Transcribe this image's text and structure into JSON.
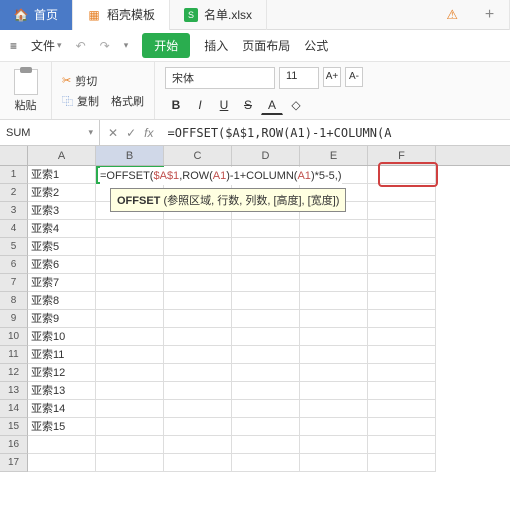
{
  "tabs": {
    "home": "首页",
    "template": "稻壳模板",
    "file_name": "名单.xlsx"
  },
  "menu": {
    "hamburger": "≡",
    "file": "文件",
    "undo": "↶",
    "redo": "↷",
    "start": "开始",
    "insert": "插入",
    "layout": "页面布局",
    "formula": "公式"
  },
  "toolbar": {
    "paste": "粘贴",
    "cut": "剪切",
    "copy": "复制",
    "format": "格式刷",
    "font_name": "宋体",
    "font_size": "11",
    "size_up": "A+",
    "size_down": "A-",
    "bold": "B",
    "italic": "I",
    "underline": "U",
    "strike": "S",
    "fontA": "A",
    "fill": "◇"
  },
  "formula_bar": {
    "name_box": "SUM",
    "cancel": "✕",
    "confirm": "✓",
    "fx": "fx",
    "value": "=OFFSET($A$1,ROW(A1)-1+COLUMN(A"
  },
  "columns": [
    "A",
    "B",
    "C",
    "D",
    "E",
    "F"
  ],
  "cell_formula": {
    "pre": "=OFFSET(",
    "ref1": "$A$1",
    "mid1": ",ROW(",
    "ref2": "A1",
    "mid2": ")-1+COLUMN(",
    "ref3": "A1",
    "mid3": ")",
    "tail": "*5-5,)"
  },
  "tooltip": {
    "fn": "OFFSET",
    "args": " (参照区域, 行数, 列数, [高度], [宽度])"
  },
  "colA": [
    "亚索1",
    "亚索2",
    "亚索3",
    "亚索4",
    "亚索5",
    "亚索6",
    "亚索7",
    "亚索8",
    "亚索9",
    "亚索10",
    "亚索11",
    "亚索12",
    "亚索13",
    "亚索14",
    "亚索15",
    "",
    ""
  ]
}
